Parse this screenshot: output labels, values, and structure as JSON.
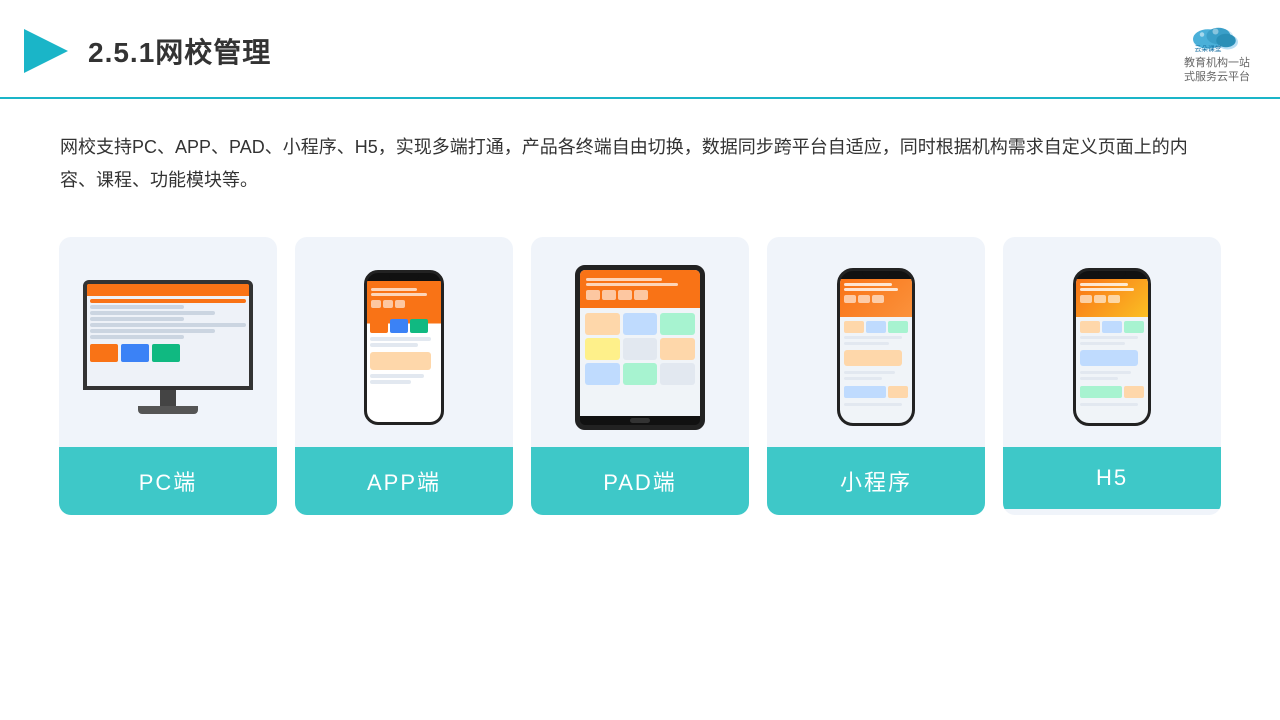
{
  "header": {
    "title": "2.5.1网校管理",
    "logo_name": "云朵课堂",
    "logo_sub": "教育机构一站\n式服务云平台",
    "logo_url": "yunduoketang.com"
  },
  "description": {
    "text": "网校支持PC、APP、PAD、小程序、H5，实现多端打通，产品各终端自由切换，数据同步跨平台自适应，同时根据机构需求自定义页面上的内容、课程、功能模块等。"
  },
  "cards": [
    {
      "id": "pc",
      "label": "PC端"
    },
    {
      "id": "app",
      "label": "APP端"
    },
    {
      "id": "pad",
      "label": "PAD端"
    },
    {
      "id": "miniprogram",
      "label": "小程序"
    },
    {
      "id": "h5",
      "label": "H5"
    }
  ],
  "colors": {
    "accent": "#3ec8c8",
    "header_border": "#1ab5c8",
    "title": "#333333",
    "card_bg": "#f0f4fa"
  }
}
